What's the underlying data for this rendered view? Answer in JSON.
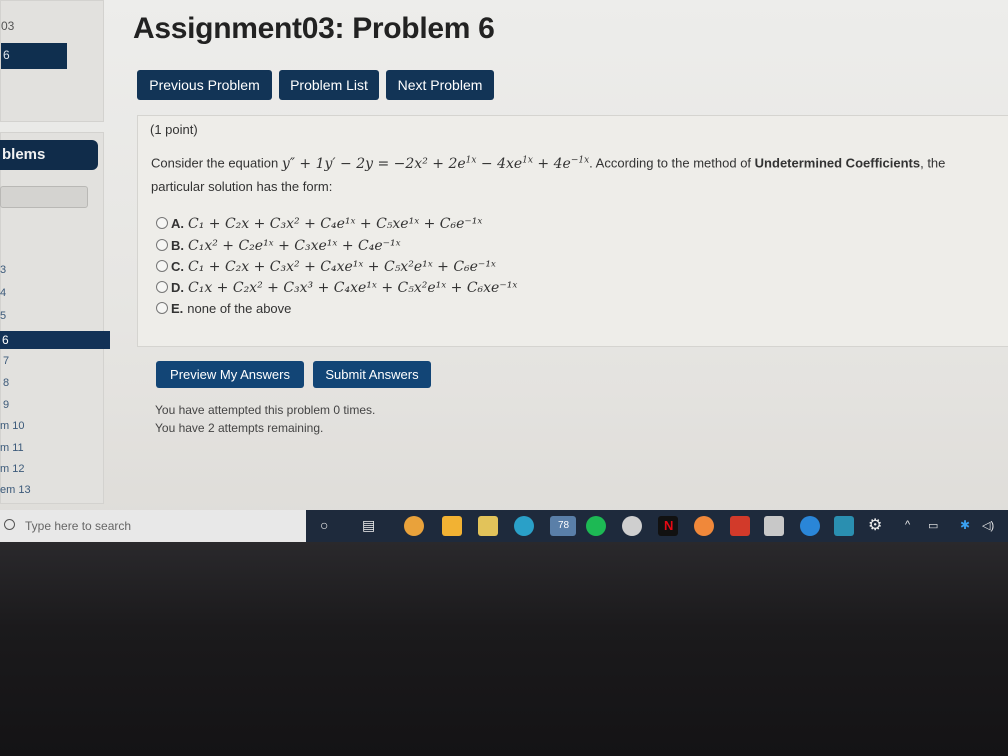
{
  "sidebar": {
    "top_text": "03",
    "top_bar_text": "6",
    "problems_label": "blems",
    "items": [
      "3",
      "4",
      "5",
      "6",
      "7",
      "8",
      "9",
      "m 10",
      "m 11",
      "m 12",
      "em 13"
    ]
  },
  "header": {
    "title": "Assignment03: Problem 6"
  },
  "nav": {
    "prev": "Previous Problem",
    "list": "Problem List",
    "next": "Next Problem"
  },
  "problem": {
    "points": "(1 point)",
    "statement_prefix": "Consider the equation",
    "statement_mid": "According to the method of",
    "statement_bold": "Undetermined Coefficients",
    "statement_suffix": ", the",
    "statement_line2": "particular solution has the form:",
    "options": [
      {
        "letter": "A.",
        "text": "C₁ + C₂x + C₃x² + C₄e¹ˣ + C₅xe¹ˣ + C₆e⁻¹ˣ"
      },
      {
        "letter": "B.",
        "text": "C₁x² + C₂e¹ˣ + C₃xe¹ˣ + C₄e⁻¹ˣ"
      },
      {
        "letter": "C.",
        "text": "C₁ + C₂x + C₃x² + C₄xe¹ˣ + C₅x²e¹ˣ + C₆e⁻¹ˣ"
      },
      {
        "letter": "D.",
        "text": "C₁x + C₂x² + C₃x³ + C₄xe¹ˣ + C₅x²e¹ˣ + C₆xe⁻¹ˣ"
      },
      {
        "letter": "E.",
        "text": "none of the above"
      }
    ]
  },
  "actions": {
    "preview": "Preview My Answers",
    "submit": "Submit Answers"
  },
  "attempts": {
    "line1": "You have attempted this problem 0 times.",
    "line2": "You have 2 attempts remaining."
  },
  "taskbar": {
    "search_placeholder": "Type here to search",
    "badge": "78",
    "icons": [
      "cortana-icon",
      "task-view-icon",
      "app-icon",
      "store-icon",
      "file-explorer-icon",
      "edge-icon",
      "weather-icon",
      "spotify-icon",
      "bitcoin-icon",
      "netflix-icon",
      "firefox-icon",
      "app-red-icon",
      "acrobat-icon",
      "hp-icon",
      "app-teal-icon",
      "settings-icon",
      "chevron-up-icon",
      "network-icon",
      "bluetooth-icon",
      "volume-icon"
    ],
    "colors": {
      "taskbar": "#1e2a3c",
      "accent": "#124576"
    }
  }
}
